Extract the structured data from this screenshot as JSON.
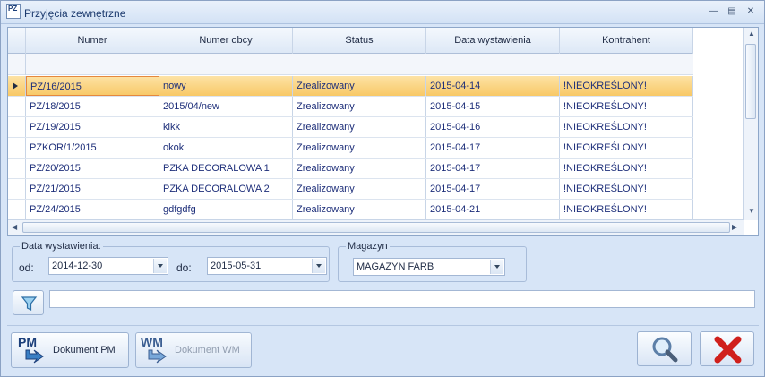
{
  "window": {
    "icon_text": "PZ",
    "title": "Przyjęcia zewnętrzne"
  },
  "grid": {
    "columns": [
      "Numer",
      "Numer obcy",
      "Status",
      "Data wystawienia",
      "Kontrahent"
    ],
    "rows": [
      {
        "numer": "PZ/16/2015",
        "numer_obcy": "nowy",
        "status": "Zrealizowany",
        "data": "2015-04-14",
        "kontrahent": "!NIEOKREŚLONY!"
      },
      {
        "numer": "PZ/18/2015",
        "numer_obcy": "2015/04/new",
        "status": "Zrealizowany",
        "data": "2015-04-15",
        "kontrahent": "!NIEOKREŚLONY!"
      },
      {
        "numer": "PZ/19/2015",
        "numer_obcy": "klkk",
        "status": "Zrealizowany",
        "data": "2015-04-16",
        "kontrahent": "!NIEOKREŚLONY!"
      },
      {
        "numer": "PZKOR/1/2015",
        "numer_obcy": "okok",
        "status": "Zrealizowany",
        "data": "2015-04-17",
        "kontrahent": "!NIEOKREŚLONY!"
      },
      {
        "numer": "PZ/20/2015",
        "numer_obcy": "PZKA DECORALOWA 1",
        "status": "Zrealizowany",
        "data": "2015-04-17",
        "kontrahent": "!NIEOKREŚLONY!"
      },
      {
        "numer": "PZ/21/2015",
        "numer_obcy": "PZKA DECORALOWA 2",
        "status": "Zrealizowany",
        "data": "2015-04-17",
        "kontrahent": "!NIEOKREŚLONY!"
      },
      {
        "numer": "PZ/24/2015",
        "numer_obcy": "gdfgdfg",
        "status": "Zrealizowany",
        "data": "2015-04-21",
        "kontrahent": "!NIEOKREŚLONY!"
      }
    ],
    "selected_row": 0
  },
  "date_filter": {
    "legend": "Data wystawienia:",
    "from_label": "od:",
    "from_value": "2014-12-30",
    "to_label": "do:",
    "to_value": "2015-05-31"
  },
  "warehouse": {
    "legend": "Magazyn",
    "value": "MAGAZYN FARB"
  },
  "search": {
    "value": ""
  },
  "buttons": {
    "pm_icon_text": "PM",
    "pm_label": "Dokument PM",
    "wm_icon_text": "WM",
    "wm_label": "Dokument WM"
  },
  "colors": {
    "accent": "#1c3f7a",
    "selection": "#f8c866",
    "close_red": "#d0201c"
  }
}
